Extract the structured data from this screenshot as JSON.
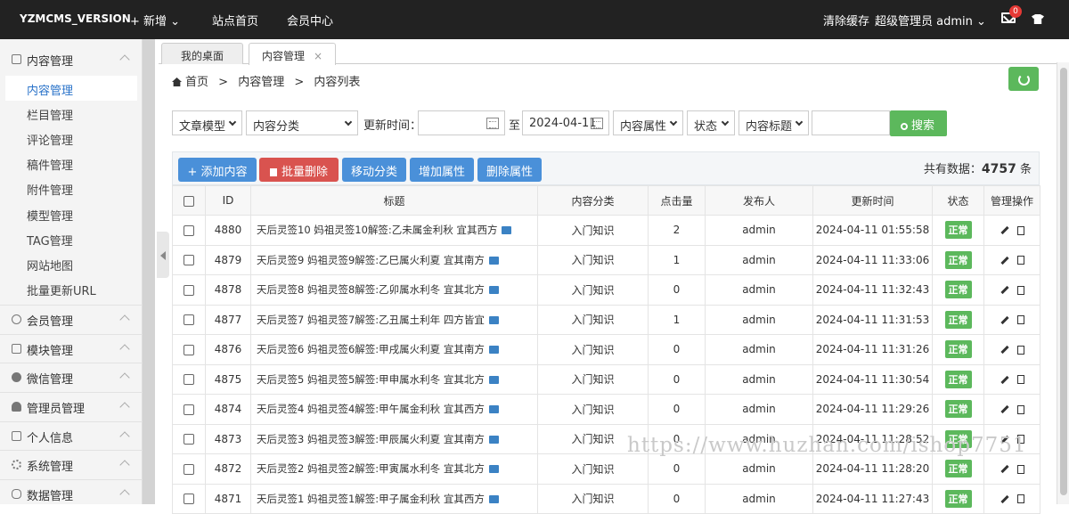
{
  "topbar": {
    "brand": "YZMCMS_VERSION",
    "new_label": "+ 新增 ⌄",
    "site_home": "站点首页",
    "member_center": "会员中心",
    "clear_cache": "清除缓存",
    "admin_label": "超级管理员  admin ⌄",
    "mail_count": "0"
  },
  "sidebar": {
    "groups": [
      {
        "label": "内容管理",
        "icon": "list-icon"
      },
      {
        "label": "会员管理",
        "icon": "user-icon"
      },
      {
        "label": "模块管理",
        "icon": "grid-icon"
      },
      {
        "label": "微信管理",
        "icon": "wechat-icon"
      },
      {
        "label": "管理员管理",
        "icon": "admin-icon"
      },
      {
        "label": "个人信息",
        "icon": "card-icon"
      },
      {
        "label": "系统管理",
        "icon": "gear-icon"
      },
      {
        "label": "数据管理",
        "icon": "database-icon"
      }
    ],
    "items": [
      "内容管理",
      "栏目管理",
      "评论管理",
      "稿件管理",
      "附件管理",
      "模型管理",
      "TAG管理",
      "网站地图",
      "批量更新URL"
    ]
  },
  "tabs": {
    "desktop": "我的桌面",
    "content": "内容管理",
    "close": "×"
  },
  "breadcrumb": {
    "home": "首页",
    "sep1": ">",
    "section": "内容管理",
    "sep2": ">",
    "page": "内容列表"
  },
  "filters": {
    "model": "文章模型",
    "category": "内容分类",
    "update_time_label": "更新时间：",
    "start_date": "",
    "to_label": "至",
    "end_date": "2024-04-11",
    "attribute": "内容属性",
    "status": "状态",
    "title_field": "内容标题",
    "keyword": "",
    "search_label": "搜索"
  },
  "toolbar": {
    "add": "+ 添加内容",
    "batch_delete": "批量删除",
    "move_category": "移动分类",
    "add_attr": "增加属性",
    "del_attr": "删除属性",
    "total_label": "共有数据：",
    "total_count": "4757",
    "total_unit": "条"
  },
  "table": {
    "headers": [
      "",
      "ID",
      "标题",
      "内容分类",
      "点击量",
      "发布人",
      "更新时间",
      "状态",
      "管理操作"
    ],
    "rows": [
      {
        "id": "4880",
        "title": "天后灵签10 妈祖灵签10解签:乙未属金利秋 宜其西方",
        "category": "入门知识",
        "clicks": "2",
        "author": "admin",
        "time": "2024-04-11 01:55:58",
        "status": "正常"
      },
      {
        "id": "4879",
        "title": "天后灵签9 妈祖灵签9解签:乙巳属火利夏 宜其南方",
        "category": "入门知识",
        "clicks": "1",
        "author": "admin",
        "time": "2024-04-11 11:33:06",
        "status": "正常"
      },
      {
        "id": "4878",
        "title": "天后灵签8 妈祖灵签8解签:乙卯属水利冬 宜其北方",
        "category": "入门知识",
        "clicks": "0",
        "author": "admin",
        "time": "2024-04-11 11:32:43",
        "status": "正常"
      },
      {
        "id": "4877",
        "title": "天后灵签7 妈祖灵签7解签:乙丑属土利年 四方皆宜",
        "category": "入门知识",
        "clicks": "1",
        "author": "admin",
        "time": "2024-04-11 11:31:53",
        "status": "正常"
      },
      {
        "id": "4876",
        "title": "天后灵签6 妈祖灵签6解签:甲戌属火利夏 宜其南方",
        "category": "入门知识",
        "clicks": "0",
        "author": "admin",
        "time": "2024-04-11 11:31:26",
        "status": "正常"
      },
      {
        "id": "4875",
        "title": "天后灵签5 妈祖灵签5解签:甲申属水利冬 宜其北方",
        "category": "入门知识",
        "clicks": "0",
        "author": "admin",
        "time": "2024-04-11 11:30:54",
        "status": "正常"
      },
      {
        "id": "4874",
        "title": "天后灵签4 妈祖灵签4解签:甲午属金利秋 宜其西方",
        "category": "入门知识",
        "clicks": "0",
        "author": "admin",
        "time": "2024-04-11 11:29:26",
        "status": "正常"
      },
      {
        "id": "4873",
        "title": "天后灵签3 妈祖灵签3解签:甲辰属火利夏 宜其南方",
        "category": "入门知识",
        "clicks": "0",
        "author": "admin",
        "time": "2024-04-11 11:28:52",
        "status": "正常"
      },
      {
        "id": "4872",
        "title": "天后灵签2 妈祖灵签2解签:甲寅属水利冬 宜其北方",
        "category": "入门知识",
        "clicks": "0",
        "author": "admin",
        "time": "2024-04-11 11:28:20",
        "status": "正常"
      },
      {
        "id": "4871",
        "title": "天后灵签1 妈祖灵签1解签:甲子属金利秋 宜其西方",
        "category": "入门知识",
        "clicks": "0",
        "author": "admin",
        "time": "2024-04-11 11:27:43",
        "status": "正常"
      }
    ]
  },
  "watermark": "https://www.huzhan.com/ishop7751",
  "colors": {
    "topbar": "#222222",
    "primary": "#4a90d9",
    "danger": "#d9534f",
    "success": "#5cb85c",
    "link": "#2a73c9"
  }
}
